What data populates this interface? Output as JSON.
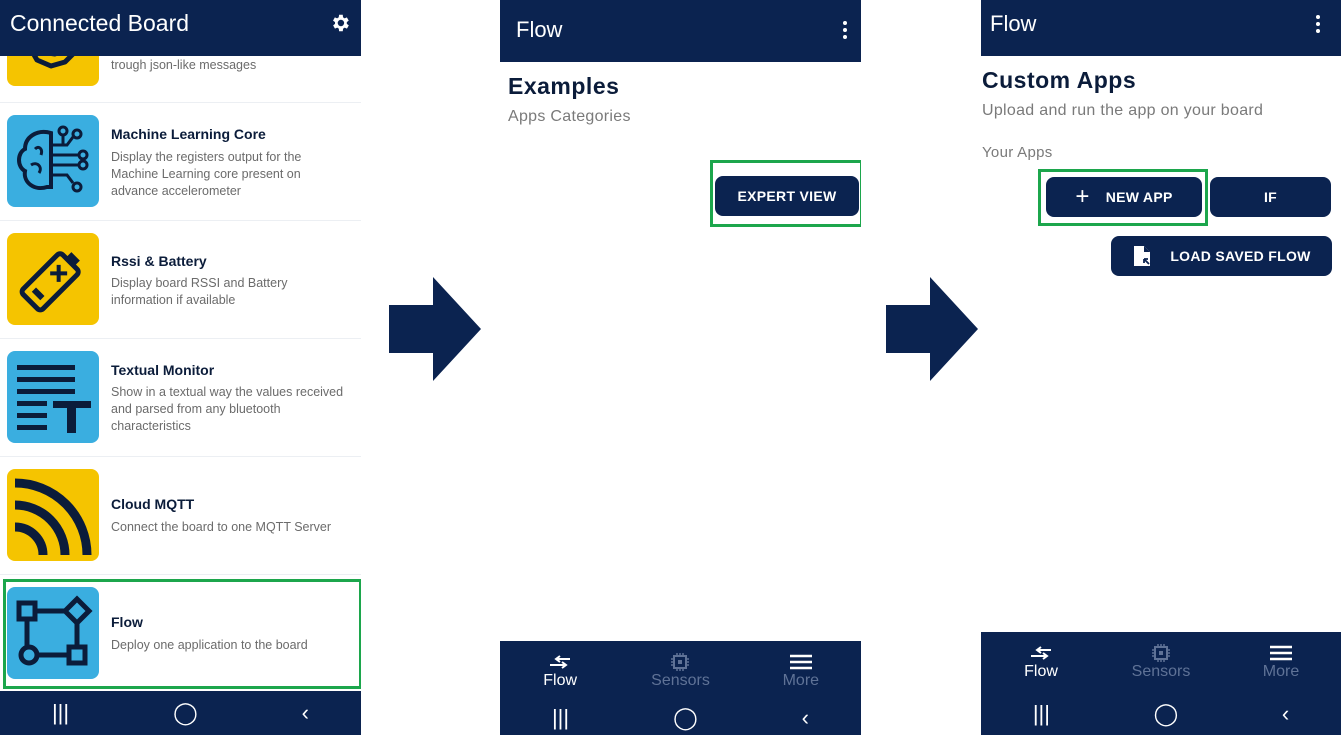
{
  "screen1": {
    "title": "Connected Board",
    "settings_icon": "gear-icon",
    "items": [
      {
        "title": "",
        "desc": "trough json-like messages",
        "icon": "gear-icon",
        "color": "#f5c400"
      },
      {
        "title": "Machine Learning Core",
        "desc": "Display the registers output for the Machine Learning core present on advance accelerometer",
        "icon": "brain-circuit-icon",
        "color": "#3aaee0"
      },
      {
        "title": "Rssi & Battery",
        "desc": "Display board RSSI and Battery information if available",
        "icon": "battery-icon",
        "color": "#f5c400"
      },
      {
        "title": "Textual Monitor",
        "desc": "Show in a textual way the values received and parsed from any bluetooth characteristics",
        "icon": "text-monitor-icon",
        "color": "#3aaee0"
      },
      {
        "title": "Cloud MQTT",
        "desc": "Connect the board to one MQTT Server",
        "icon": "wifi-signal-icon",
        "color": "#f5c400"
      },
      {
        "title": "Flow",
        "desc": "Deploy one application to the board",
        "icon": "flow-icon",
        "color": "#3aaee0"
      }
    ]
  },
  "screen2": {
    "title": "Flow",
    "heading": "Examples",
    "subheading": "Apps Categories",
    "expert_view_label": "EXPERT VIEW",
    "nav": [
      {
        "label": "Flow",
        "icon": "flow-arrows-icon",
        "active": true
      },
      {
        "label": "Sensors",
        "icon": "chip-icon",
        "active": false
      },
      {
        "label": "More",
        "icon": "menu-icon",
        "active": false
      }
    ]
  },
  "screen3": {
    "title": "Flow",
    "heading": "Custom Apps",
    "subheading": "Upload and run the app on your board",
    "your_apps": "Your Apps",
    "new_app_label": "NEW APP",
    "if_label": "IF",
    "load_saved_label": "LOAD SAVED FLOW",
    "nav": [
      {
        "label": "Flow",
        "icon": "flow-arrows-icon",
        "active": true
      },
      {
        "label": "Sensors",
        "icon": "chip-icon",
        "active": false
      },
      {
        "label": "More",
        "icon": "menu-icon",
        "active": false
      }
    ]
  },
  "colors": {
    "primary": "#0b2350",
    "highlight": "#1ca64c",
    "yellow": "#f5c400",
    "blue": "#3aaee0"
  }
}
